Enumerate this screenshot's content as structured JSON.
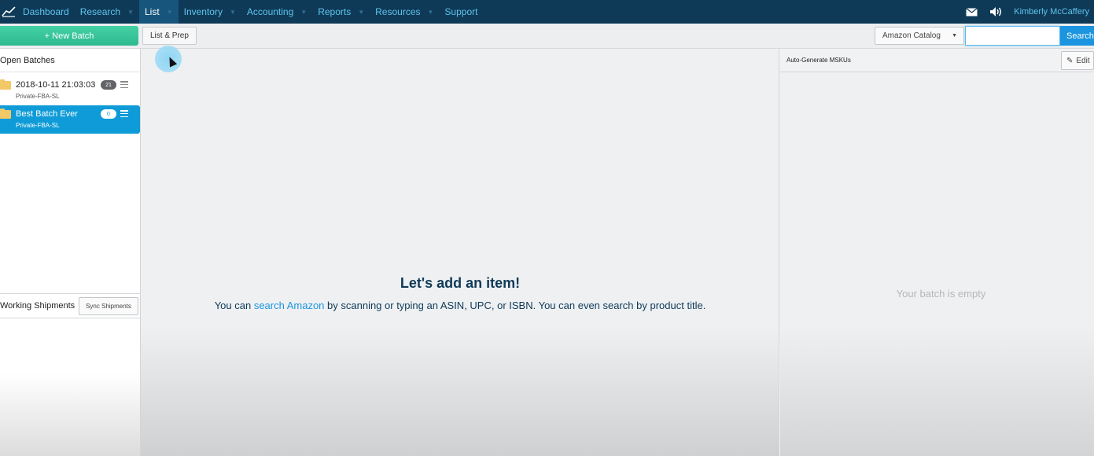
{
  "nav": {
    "items": [
      {
        "label": "Dashboard",
        "caret": false,
        "active": false
      },
      {
        "label": "Research",
        "caret": true,
        "active": false
      },
      {
        "label": "List",
        "caret": true,
        "active": true
      },
      {
        "label": "Inventory",
        "caret": true,
        "active": false
      },
      {
        "label": "Accounting",
        "caret": true,
        "active": false
      },
      {
        "label": "Reports",
        "caret": true,
        "active": false
      },
      {
        "label": "Resources",
        "caret": true,
        "active": false
      },
      {
        "label": "Support",
        "caret": false,
        "active": false
      }
    ],
    "user_name": "Kimberly McCaffery",
    "icons": [
      "logo-chart-icon",
      "mail-icon",
      "speaker-icon"
    ]
  },
  "toolbar": {
    "new_batch_label": "+  New Batch",
    "list_prep_label": "List & Prep",
    "catalog_label": "Amazon Catalog",
    "search_value": "",
    "search_label": "Search"
  },
  "left": {
    "open_batches_title": "Open Batches",
    "batches": [
      {
        "name": "2018-10-11 21:03:03",
        "sub": "Private-FBA-SL",
        "count": "21",
        "selected": false
      },
      {
        "name": "Best Batch Ever",
        "sub": "Private-FBA-SL",
        "count": "0",
        "selected": true
      }
    ],
    "working_shipments_title": "Working Shipments",
    "sync_label": "Sync Shipments"
  },
  "center": {
    "title": "Let's add an item!",
    "desc_before": "You can ",
    "desc_link": "search Amazon",
    "desc_after": " by scanning or typing an ASIN, UPC, or ISBN. You can even search by product title."
  },
  "right": {
    "header_label": "Auto-Generate MSKUs",
    "edit_label": "Edit",
    "empty_text": "Your batch is empty"
  },
  "colors": {
    "nav_bg": "#0f3a57",
    "nav_link": "#5fc4ee",
    "accent_green": "#2fb98f",
    "accent_blue": "#0e9bd7",
    "search_blue": "#1b95df"
  }
}
